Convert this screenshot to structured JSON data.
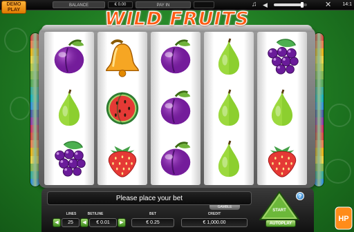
{
  "top_bar": {
    "demo_line1": "DEMO",
    "demo_line2": "PLAY",
    "balance_label": "BALANCE",
    "balance_value": "€ 0.00",
    "payin_label": "PAY IN",
    "payin_value": "",
    "volume_level": 0.85,
    "clock": "14:1"
  },
  "title": "WILD FRUITS",
  "reels": [
    [
      "plum",
      "pear",
      "grapes"
    ],
    [
      "bell",
      "watermelon",
      "strawberry"
    ],
    [
      "plum",
      "plum",
      "plum"
    ],
    [
      "pear",
      "pear",
      "pear"
    ],
    [
      "grapes",
      "pear",
      "strawberry"
    ]
  ],
  "side_colors": [
    "#e53935",
    "#ff7043",
    "#ffb300",
    "#fdd835",
    "#c0ca33",
    "#7cb342",
    "#43a047",
    "#26a69a",
    "#00acc1",
    "#1e88e5",
    "#3949ab",
    "#8e24aa",
    "#d81b60",
    "#e53935",
    "#ff7043",
    "#ffb300",
    "#fdd835",
    "#7cb342",
    "#26a69a",
    "#1e88e5"
  ],
  "panel": {
    "message": "Please place your bet",
    "gamble": "GAMBLE",
    "lines_label": "LINES",
    "lines_value": "25",
    "bet_line_label": "BET/LINE",
    "bet_line_value": "€ 0.01",
    "bet_label": "BET",
    "bet_value": "€ 0.25",
    "credit_label": "CREDIT",
    "credit_value": "€ 1,000.00",
    "start_label": "START",
    "autoplay_label": "AUTOPLAY",
    "help_label": "?"
  },
  "logo_text": "HP",
  "colors": {
    "title": "#ff5a12",
    "background": "#2f962f",
    "start_button": "#7cc444"
  }
}
